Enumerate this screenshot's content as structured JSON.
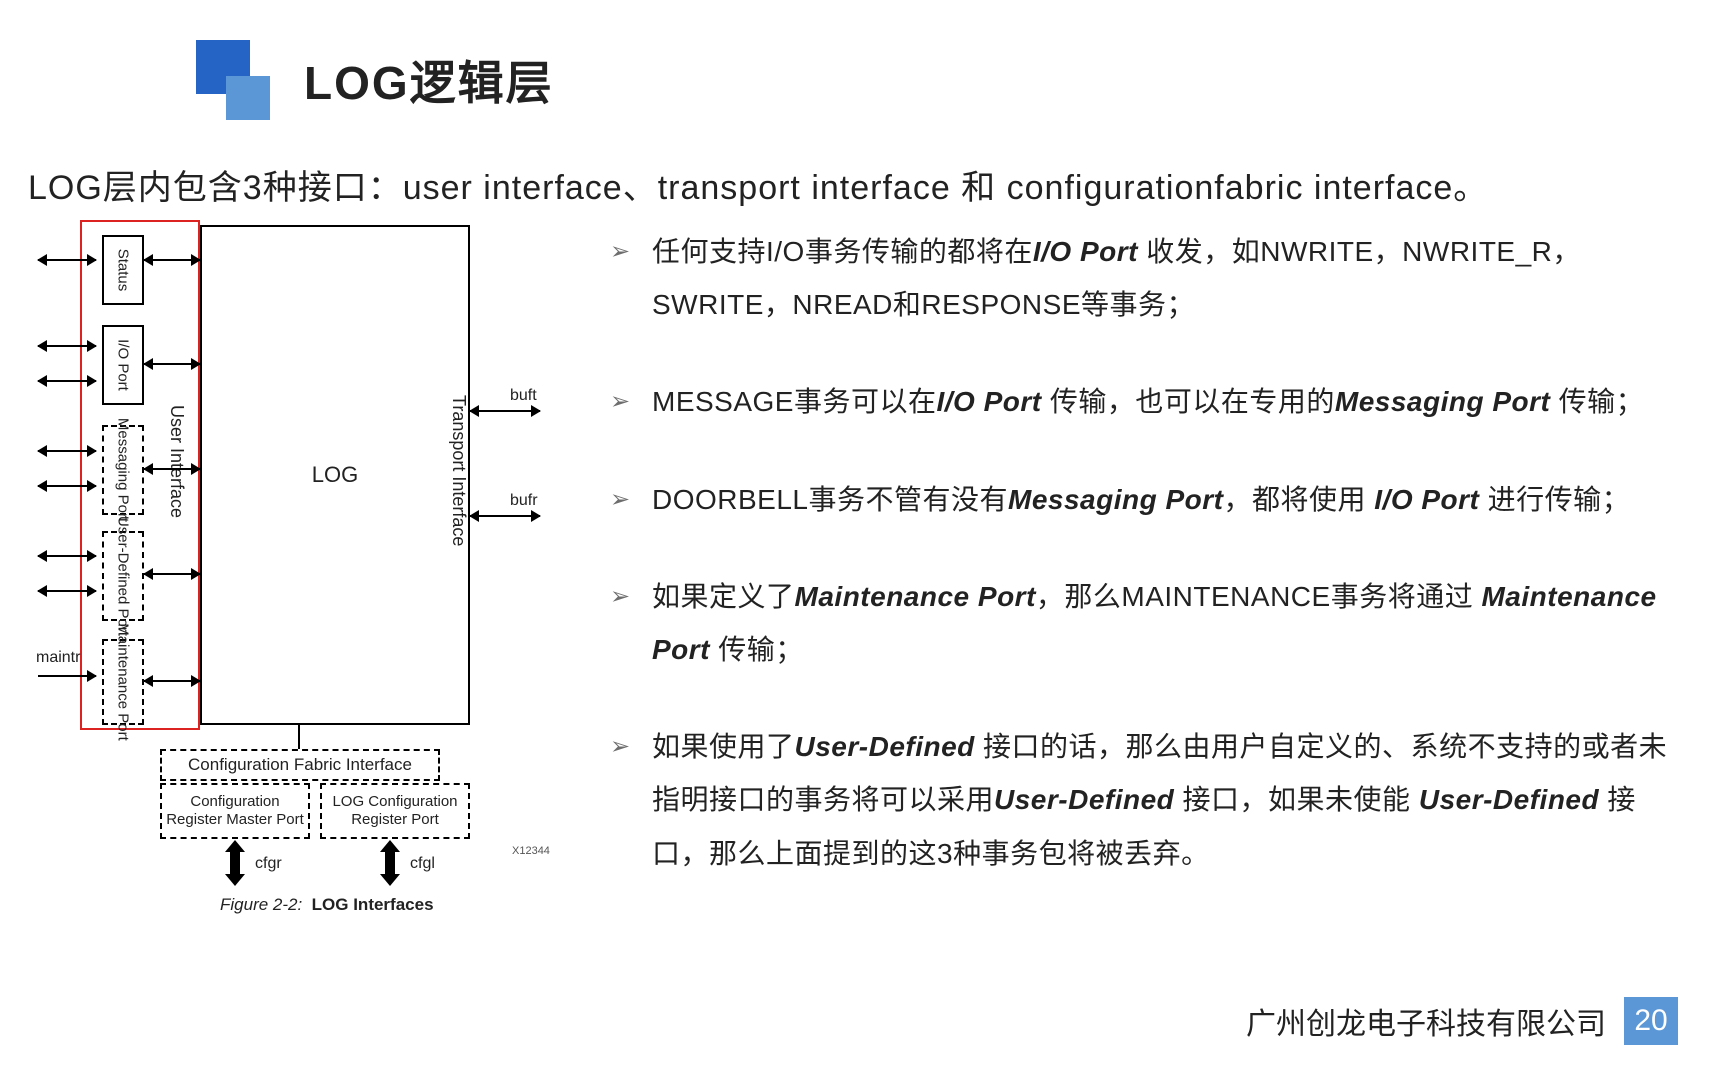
{
  "title": "LOG逻辑层",
  "intro": "LOG层内包含3种接口：user interface、transport interface 和 configurationfabric interface。",
  "diagram": {
    "block_label": "LOG",
    "user_if": "User Interface",
    "transport_if": "Transport Interface",
    "status": "Status",
    "io_port": "I/O Port",
    "msg_port": "Messaging Port",
    "ud_port": "User-Defined Port",
    "maint_port": "Maintenance Port",
    "maintr": "maintr",
    "buft": "buft",
    "bufr": "bufr",
    "cfg_fabric": "Configuration Fabric Interface",
    "cfg_master": "Configuration Register Master Port",
    "cfg_log": "LOG Configuration Register Port",
    "cfgr": "cfgr",
    "cfgl": "cfgl",
    "xref": "X12344",
    "fig_num": "Figure 2-2:",
    "fig_title": "LOG Interfaces"
  },
  "bullets": [
    {
      "pre": "任何支持I/O事务传输的都将在",
      "b1": "I/O Port",
      "mid": " 收发，如NWRITE，NWRITE_R，SWRITE，NREAD和RESPONSE等事务；"
    },
    {
      "pre": "MESSAGE事务可以在",
      "b1": "I/O Port",
      "mid": " 传输，也可以在专用的",
      "b2": "Messaging Port",
      "tail": " 传输；"
    },
    {
      "pre": "DOORBELL事务不管有没有",
      "b1": "Messaging Port",
      "mid": "，都将使用 ",
      "b2": "I/O Port",
      "tail": " 进行传输；"
    },
    {
      "pre": "如果定义了",
      "b1": "Maintenance Port",
      "mid": "，那么MAINTENANCE事务将通过 ",
      "b2": "Maintenance Port",
      "tail": " 传输；"
    },
    {
      "pre": "如果使用了",
      "b1": "User-Defined",
      "mid": " 接口的话，那么由用户自定义的、系统不支持的或者未指明接口的事务将可以采用",
      "b2": "User-Defined",
      "tail": " 接口，如果未使能 ",
      "b3": "User-Defined",
      "after": " 接口，那么上面提到的这3种事务包将被丢弃。"
    }
  ],
  "footer": {
    "company": "广州创龙电子科技有限公司",
    "page": "20"
  }
}
